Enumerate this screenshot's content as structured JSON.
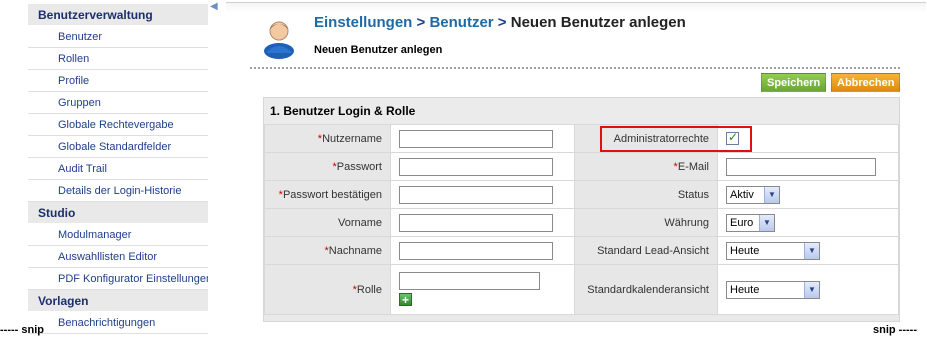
{
  "sidebar": {
    "sections": [
      {
        "title": "Benutzerverwaltung",
        "items": [
          "Benutzer",
          "Rollen",
          "Profile",
          "Gruppen",
          "Globale Rechtevergabe",
          "Globale Standardfelder",
          "Audit Trail",
          "Details der Login-Historie"
        ]
      },
      {
        "title": "Studio",
        "items": [
          "Modulmanager",
          "Auswahllisten Editor",
          "PDF Konfigurator Einstellungen"
        ]
      },
      {
        "title": "Vorlagen",
        "items": [
          "Benachrichtigungen"
        ]
      }
    ]
  },
  "header": {
    "breadcrumb": {
      "part1": "Einstellungen",
      "sep1": " > ",
      "part2": "Benutzer",
      "sep2": " > ",
      "current": "Neuen Benutzer anlegen"
    },
    "subtitle": "Neuen Benutzer anlegen"
  },
  "toolbar": {
    "save_label": "Speichern",
    "cancel_label": "Abbrechen"
  },
  "form": {
    "section_title": "1. Benutzer Login & Rolle",
    "required_marker": "*",
    "fields": {
      "username_label": "Nutzername",
      "password_label": "Passwort",
      "password_confirm_label": "Passwort bestätigen",
      "firstname_label": "Vorname",
      "lastname_label": "Nachname",
      "role_label": "Rolle",
      "admin_label": "Administratorrechte",
      "admin_checked": true,
      "email_label": "E-Mail",
      "status_label": "Status",
      "status_value": "Aktiv",
      "currency_label": "Währung",
      "currency_value": "Euro",
      "lead_view_label": "Standard Lead-Ansicht",
      "lead_view_value": "Heute",
      "calendar_view_label": "Standardkalenderansicht",
      "calendar_view_value": "Heute"
    }
  },
  "snip": {
    "left": "----- snip",
    "right": "snip -----"
  },
  "colors": {
    "accent_link": "#1f6aa5",
    "save_button": "#7cb940",
    "cancel_button": "#e89a1c",
    "highlight": "#e01010"
  }
}
